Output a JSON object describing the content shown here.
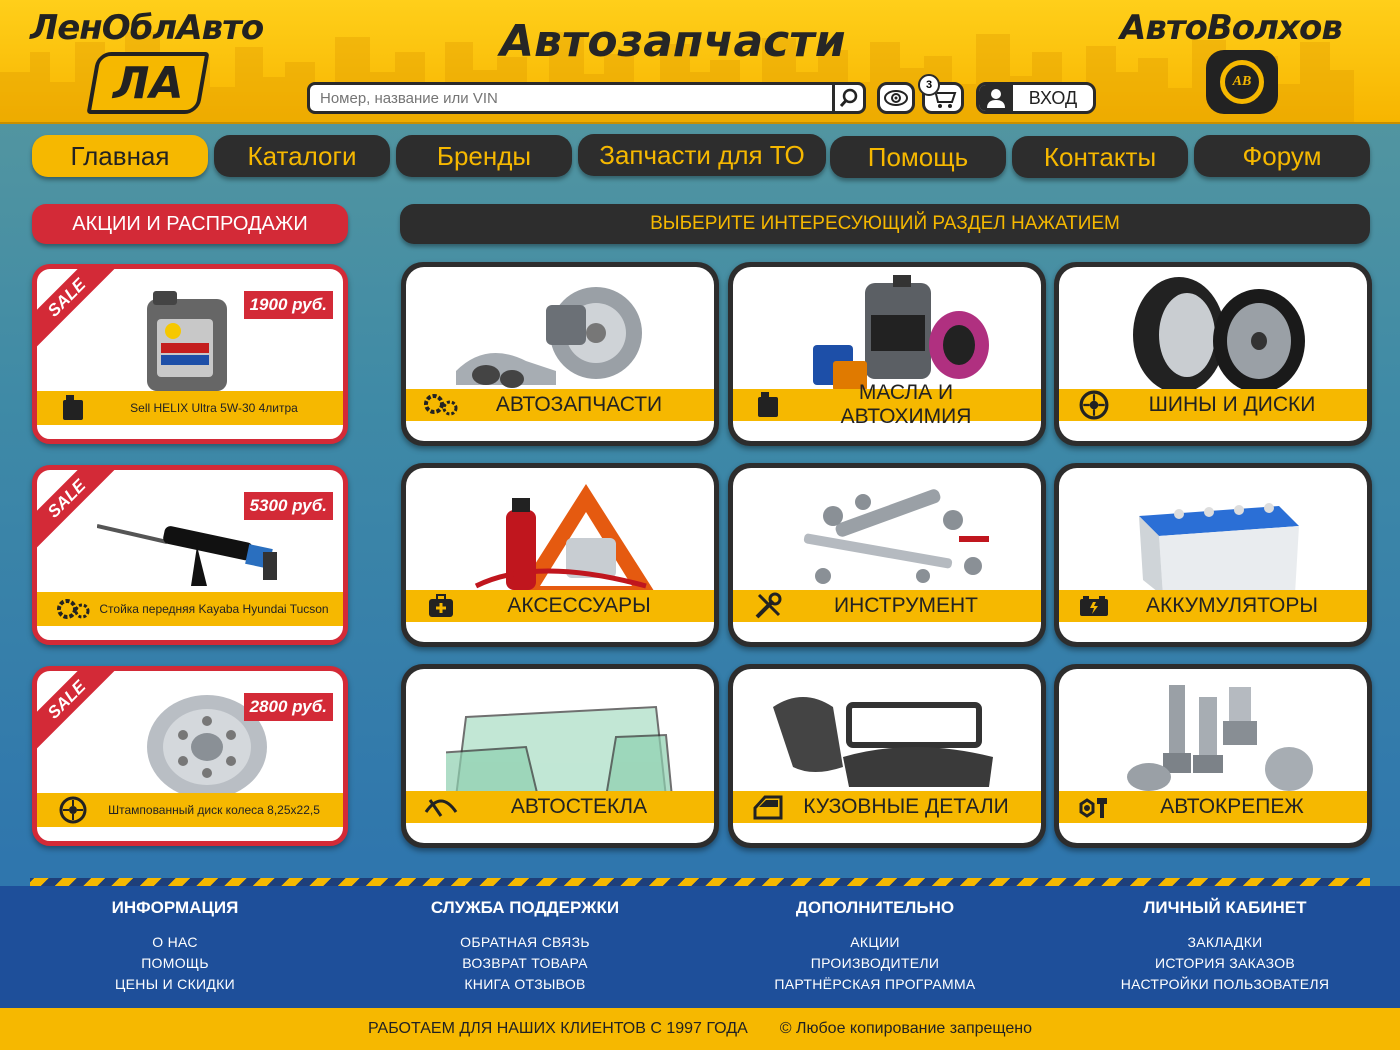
{
  "header": {
    "brand_left": "ЛенОблАвто",
    "logo_left": "ЛА",
    "title": "Автозапчасти",
    "brand_right": "АвтоВолхов",
    "logo_right": "AB",
    "search_placeholder": "Номер, название или VIN",
    "cart_count": "3",
    "login_label": "ВХОД"
  },
  "nav": [
    {
      "label": "Главная",
      "active": true
    },
    {
      "label": "Каталоги"
    },
    {
      "label": "Бренды"
    },
    {
      "label": "Запчасти для ТО"
    },
    {
      "label": "Помощь"
    },
    {
      "label": "Контакты"
    },
    {
      "label": "Форум"
    }
  ],
  "promos": {
    "heading": "АКЦИИ И РАСПРОДАЖИ",
    "items": [
      {
        "badge": "SALE",
        "price": "1900 руб.",
        "title": "Sell HELIX Ultra 5W-30 4литра",
        "icon": "oil-can-icon"
      },
      {
        "badge": "SALE",
        "price": "5300 руб.",
        "title": "Стойка передняя Kayaba Hyundai Tucson",
        "icon": "gears-icon"
      },
      {
        "badge": "SALE",
        "price": "2800 руб.",
        "title": "Штампованный диск колеса 8,25x22,5",
        "icon": "wheel-icon"
      }
    ]
  },
  "sections": {
    "heading": "ВЫБЕРИТЕ ИНТЕРЕСУЮЩИЙ РАЗДЕЛ НАЖАТИЕМ",
    "items": [
      {
        "label": "АВТОЗАПЧАСТИ",
        "icon": "gears-icon"
      },
      {
        "label": "МАСЛА И АВТОХИМИЯ",
        "icon": "oil-can-icon"
      },
      {
        "label": "ШИНЫ И ДИСКИ",
        "icon": "wheel-icon"
      },
      {
        "label": "АКСЕССУАРЫ",
        "icon": "first-aid-icon"
      },
      {
        "label": "ИНСТРУМЕНТ",
        "icon": "tools-icon"
      },
      {
        "label": "АККУМУЛЯТОРЫ",
        "icon": "battery-icon"
      },
      {
        "label": "АВТОСТЕКЛА",
        "icon": "wiper-icon"
      },
      {
        "label": "КУЗОВНЫЕ ДЕТАЛИ",
        "icon": "car-door-icon"
      },
      {
        "label": "АВТОКРЕПЕЖ",
        "icon": "bolt-nut-icon"
      }
    ]
  },
  "footer": {
    "columns": [
      {
        "title": "ИНФОРМАЦИЯ",
        "links": [
          "О НАС",
          "ПОМОЩЬ",
          "ЦЕНЫ И СКИДКИ"
        ]
      },
      {
        "title": "СЛУЖБА ПОДДЕРЖКИ",
        "links": [
          "ОБРАТНАЯ СВЯЗЬ",
          "ВОЗВРАТ ТОВАРА",
          "КНИГА ОТЗЫВОВ"
        ]
      },
      {
        "title": "ДОПОЛНИТЕЛЬНО",
        "links": [
          "АКЦИИ",
          "ПРОИЗВОДИТЕЛИ",
          "ПАРТНЁРСКАЯ ПРОГРАММА"
        ]
      },
      {
        "title": "ЛИЧНЫЙ КАБИНЕТ",
        "links": [
          "ЗАКЛАДКИ",
          "ИСТОРИЯ ЗАКАЗОВ",
          "НАСТРОЙКИ ПОЛЬЗОВАТЕЛЯ"
        ]
      }
    ],
    "since": "РАБОТАЕМ ДЛЯ НАШИХ КЛИЕНТОВ С 1997 ГОДА",
    "copyright": "©  Любое копирование запрещено"
  },
  "colors": {
    "accent": "#f6b800",
    "dark": "#2d2d2d",
    "sale": "#d32a37",
    "footer": "#1e4f9a"
  }
}
